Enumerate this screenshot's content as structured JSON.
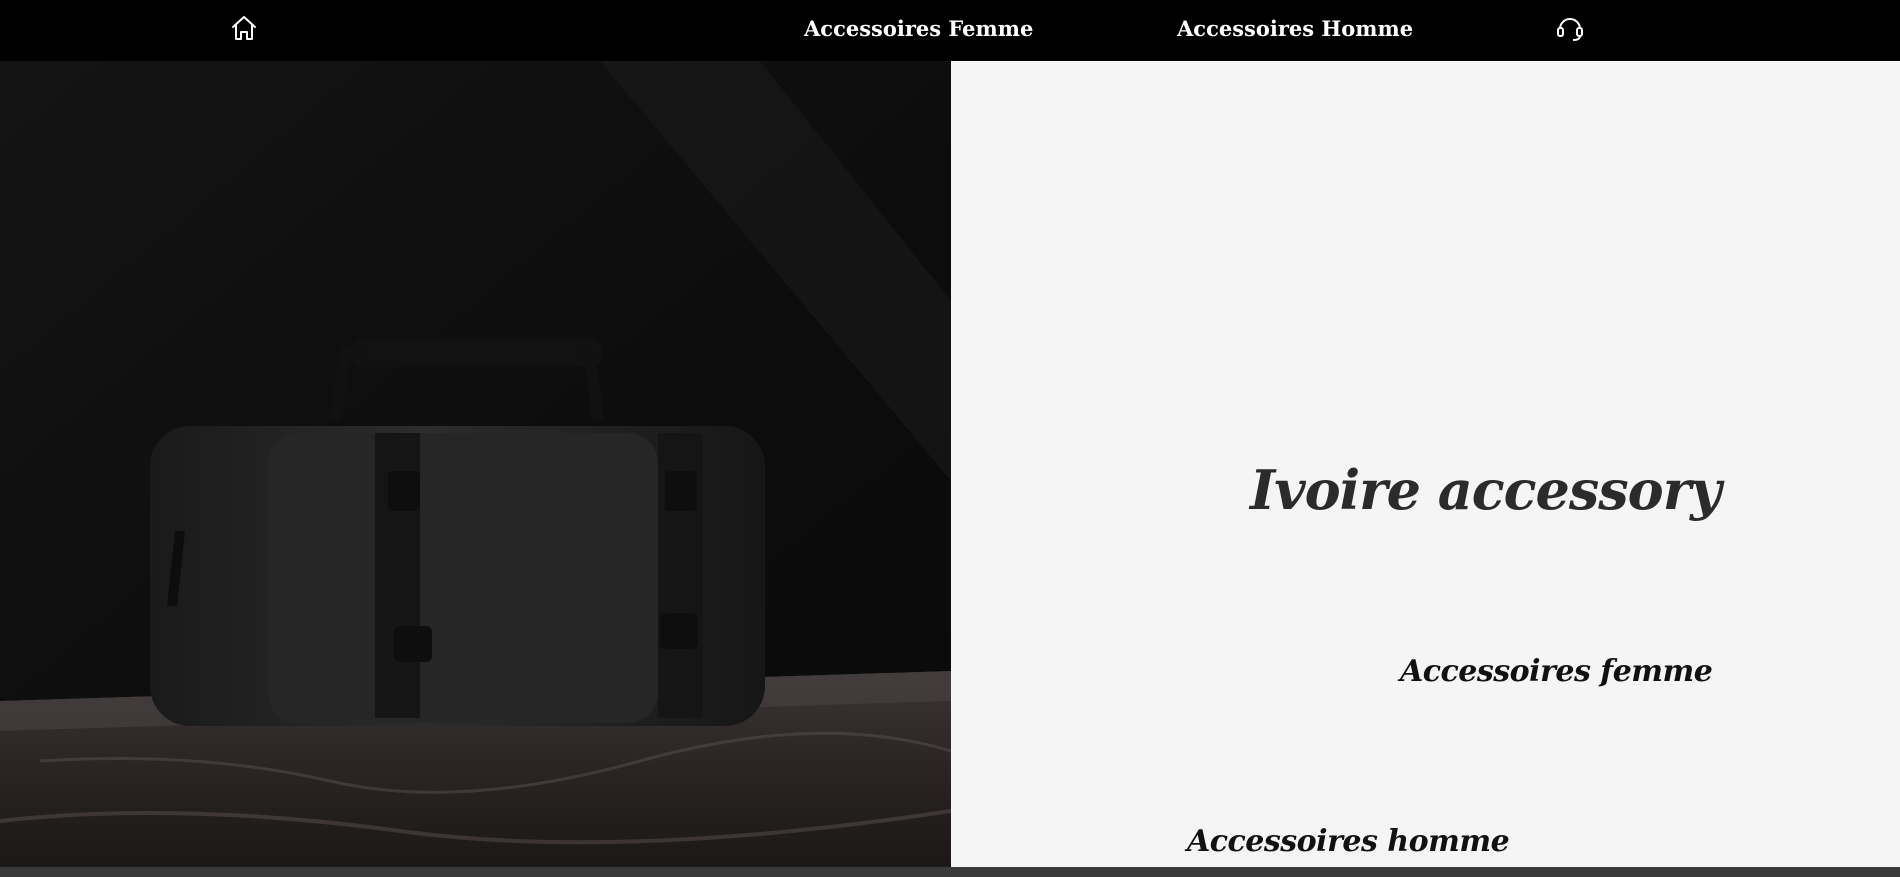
{
  "nav": {
    "home_icon": "home-icon",
    "links": [
      "Accessoires Femme",
      "Accessoires Homme"
    ],
    "support_icon": "headset-icon"
  },
  "hero": {
    "image": "black-bag-on-marble-photo"
  },
  "main": {
    "title": "Ivoire accessory",
    "femme_link": "Accessoires femme",
    "homme_link": "Accessoires homme"
  },
  "colors": {
    "navbar_bg": "#000000",
    "panel_bg": "#f5f5f5",
    "title_color": "#2b2b2b"
  }
}
